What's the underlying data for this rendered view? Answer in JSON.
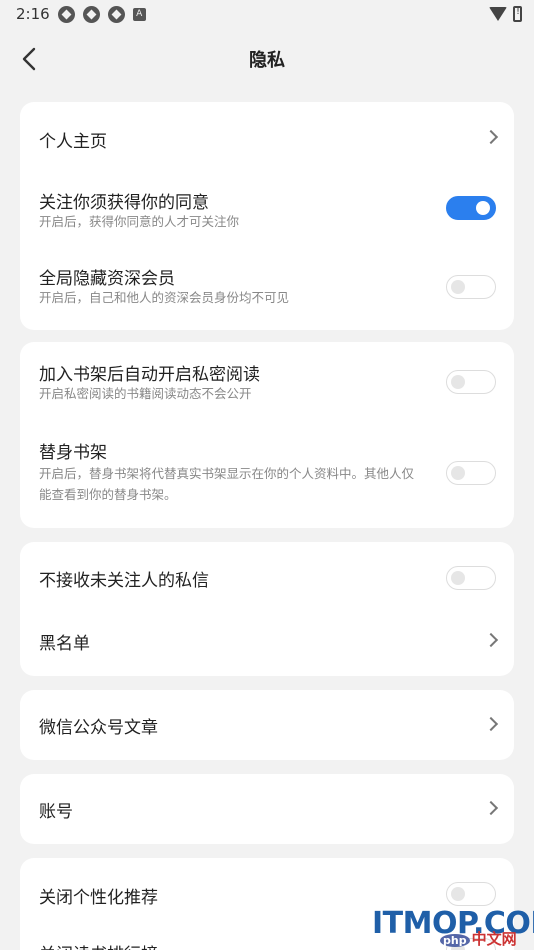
{
  "status_bar": {
    "time": "2:16",
    "icons": [
      "sync-icon",
      "sync-icon",
      "sync-icon",
      "a-icon"
    ],
    "a_label": "A"
  },
  "header": {
    "title": "隐私"
  },
  "sections": [
    {
      "items": [
        {
          "title": "个人主页",
          "type": "link"
        },
        {
          "title": "关注你须获得你的同意",
          "subtitle": "开启后，获得你同意的人才可关注你",
          "type": "toggle",
          "on": true
        },
        {
          "title": "全局隐藏资深会员",
          "subtitle": "开启后，自己和他人的资深会员身份均不可见",
          "type": "toggle",
          "on": false
        }
      ]
    },
    {
      "items": [
        {
          "title": "加入书架后自动开启私密阅读",
          "subtitle": "开启私密阅读的书籍阅读动态不会公开",
          "type": "toggle",
          "on": false
        },
        {
          "title": "替身书架",
          "subtitle_line1": "开启后，替身书架将代替真实书架显示在你的个人资料中。其他人仅",
          "subtitle_line2": "能查看到你的替身书架。",
          "type": "toggle",
          "on": false
        }
      ]
    },
    {
      "items": [
        {
          "title": "不接收未关注人的私信",
          "type": "toggle",
          "on": false
        },
        {
          "title": "黑名单",
          "type": "link"
        }
      ]
    },
    {
      "items": [
        {
          "title": "微信公众号文章",
          "type": "link"
        }
      ]
    },
    {
      "items": [
        {
          "title": "账号",
          "type": "link"
        }
      ]
    },
    {
      "items": [
        {
          "title": "关闭个性化推荐",
          "type": "toggle",
          "on": false
        },
        {
          "title": "关闭读书排行榜",
          "type": "toggle",
          "on": false
        }
      ]
    }
  ],
  "watermark": {
    "text": "ITMOP.COM",
    "php": "php",
    "cn": "中文网"
  },
  "colors": {
    "accent": "#2b7fee",
    "background": "#f2f2f2",
    "card": "#ffffff"
  }
}
